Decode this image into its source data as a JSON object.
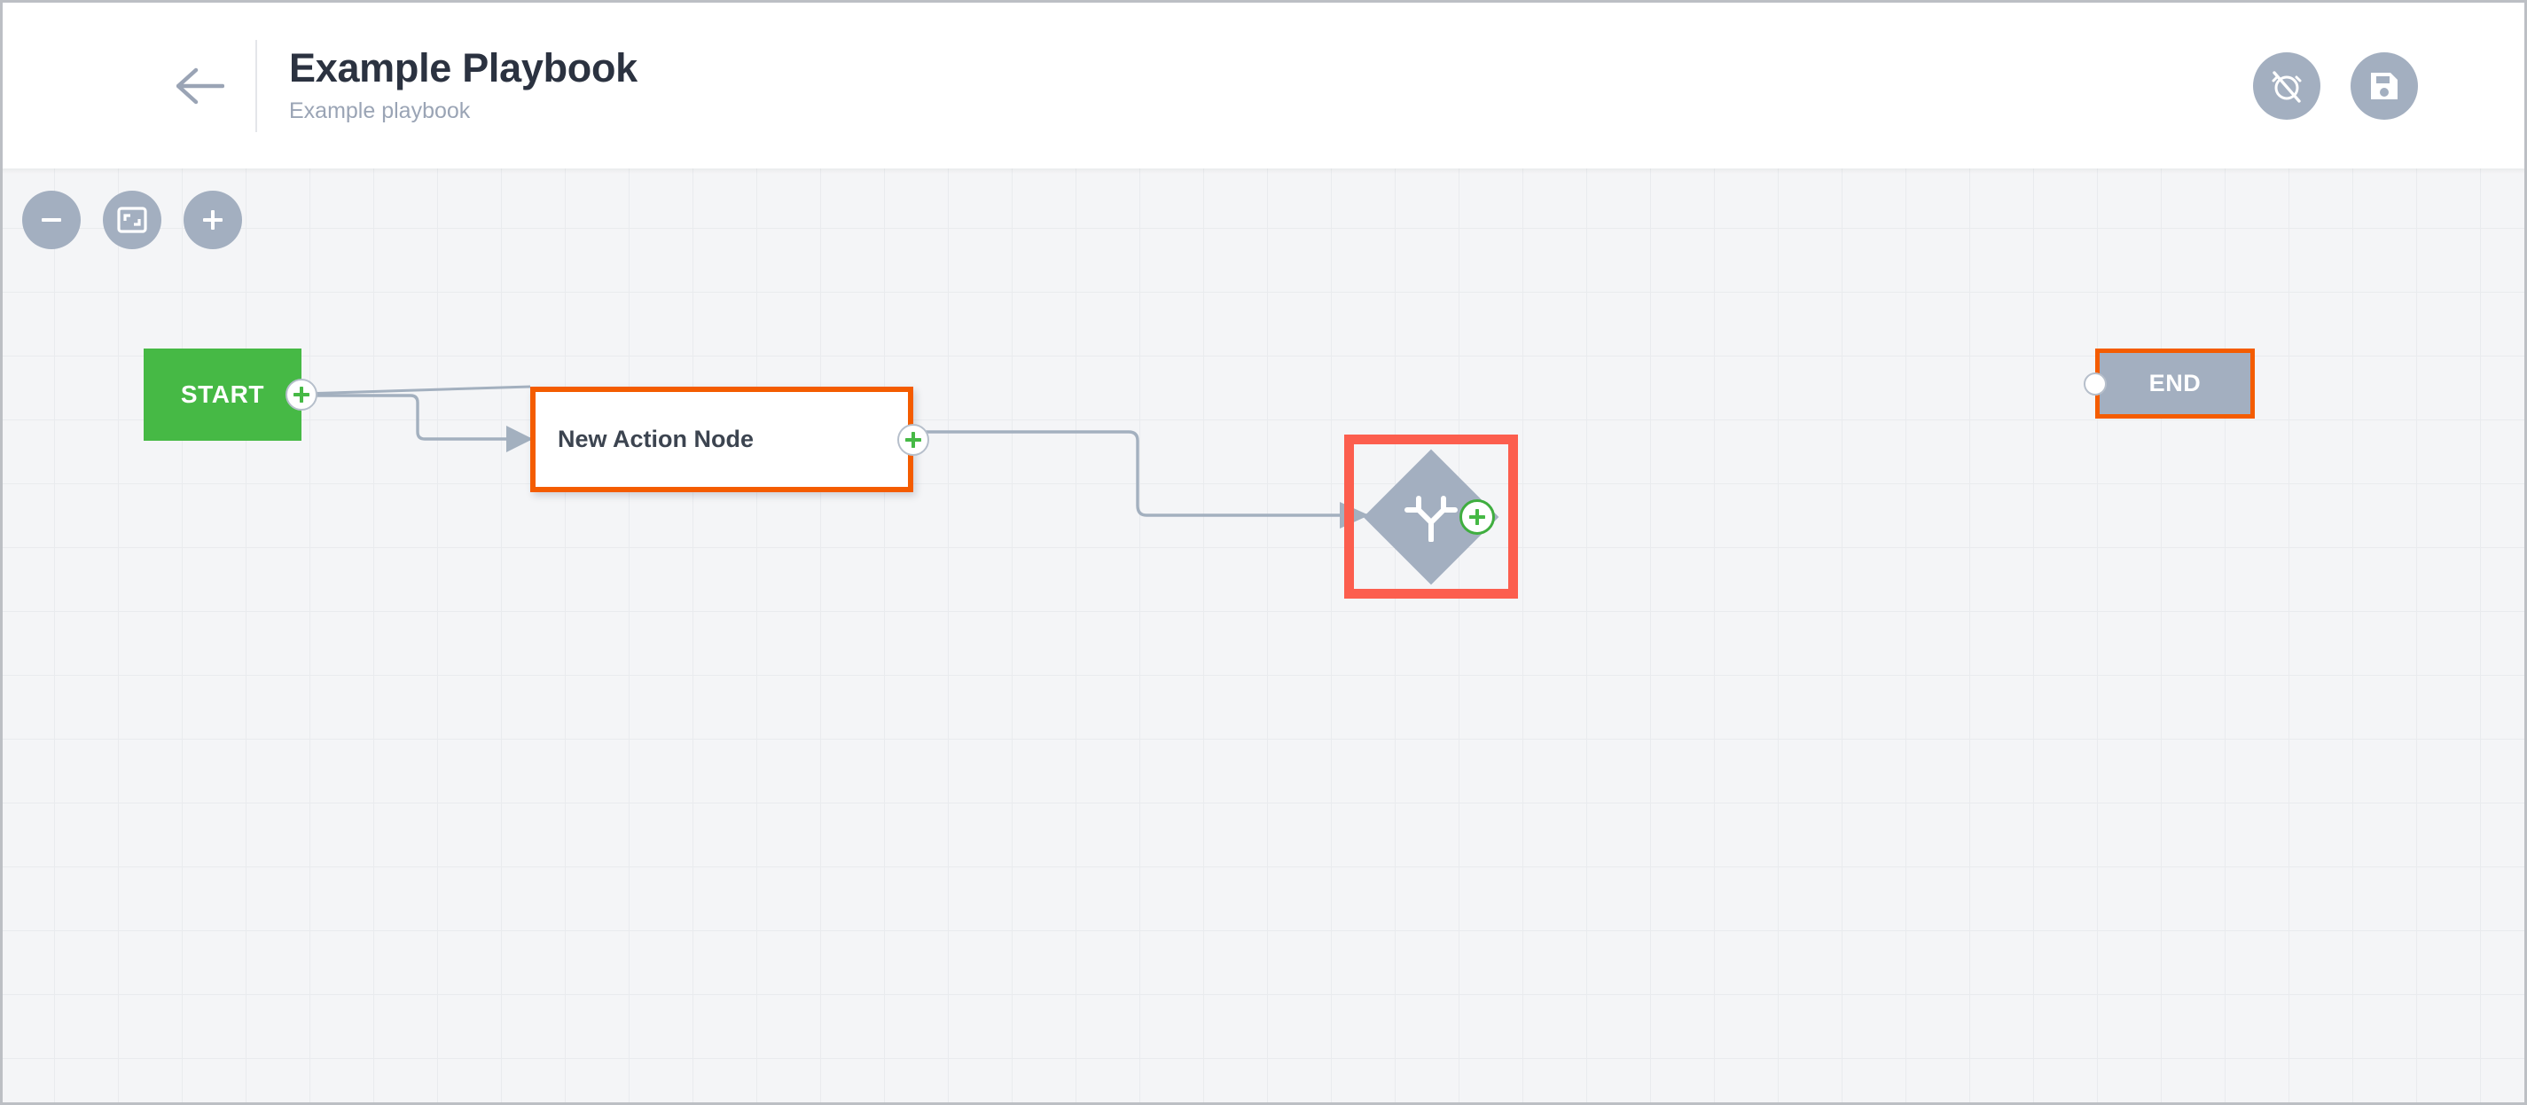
{
  "header": {
    "back_icon": "arrow-left-icon",
    "title": "Example Playbook",
    "subtitle": "Example playbook",
    "actions": [
      {
        "name": "alarm-off-button",
        "icon": "alarm-off-icon",
        "label": "Disable schedule"
      },
      {
        "name": "save-button",
        "icon": "floppy-disk-icon",
        "label": "Save"
      }
    ]
  },
  "canvas": {
    "zoom_controls": [
      {
        "name": "zoom-out-button",
        "icon": "minus-icon",
        "label": "Zoom out"
      },
      {
        "name": "fit-to-screen-button",
        "icon": "fit-screen-icon",
        "label": "Fit to screen"
      },
      {
        "name": "zoom-in-button",
        "icon": "plus-icon",
        "label": "Zoom in"
      }
    ],
    "grid": "on",
    "background_color": "#f4f5f7",
    "grid_line_color": "#e9ebee"
  },
  "flow": {
    "nodes": [
      {
        "id": "start",
        "type": "start",
        "label": "START",
        "shape": "rectangle",
        "fill": "#46b945",
        "text_color": "#ffffff",
        "selected": false,
        "handle": "plus"
      },
      {
        "id": "action-1",
        "type": "action",
        "label": "New Action Node",
        "shape": "rectangle",
        "fill": "#ffffff",
        "border_color": "#f45c00",
        "text_color": "#3c4450",
        "selected": true,
        "handle": "plus"
      },
      {
        "id": "decision-1",
        "type": "decision",
        "label": "",
        "icon": "branch-fork-icon",
        "shape": "diamond",
        "fill": "#a3afc0",
        "selection_color": "#fc5e4e",
        "selected": true,
        "handle": "plus"
      },
      {
        "id": "end",
        "type": "end",
        "label": "END",
        "shape": "rectangle",
        "fill": "#a3afc0",
        "border_color": "#f45c00",
        "text_color": "#ffffff",
        "selected": false,
        "handle": "dot"
      }
    ],
    "edges": [
      {
        "from": "start",
        "to": "action-1",
        "style": "straight",
        "arrow": false
      },
      {
        "from": "start",
        "to": "action-1",
        "style": "orthogonal",
        "arrow": true
      },
      {
        "from": "action-1",
        "to": "decision-1",
        "style": "orthogonal",
        "arrow": true
      }
    ],
    "edge_color": "#a3b0bf",
    "accent_green": "#3fae3f",
    "accent_orange": "#f45c00",
    "accent_red": "#fc5e4e"
  }
}
